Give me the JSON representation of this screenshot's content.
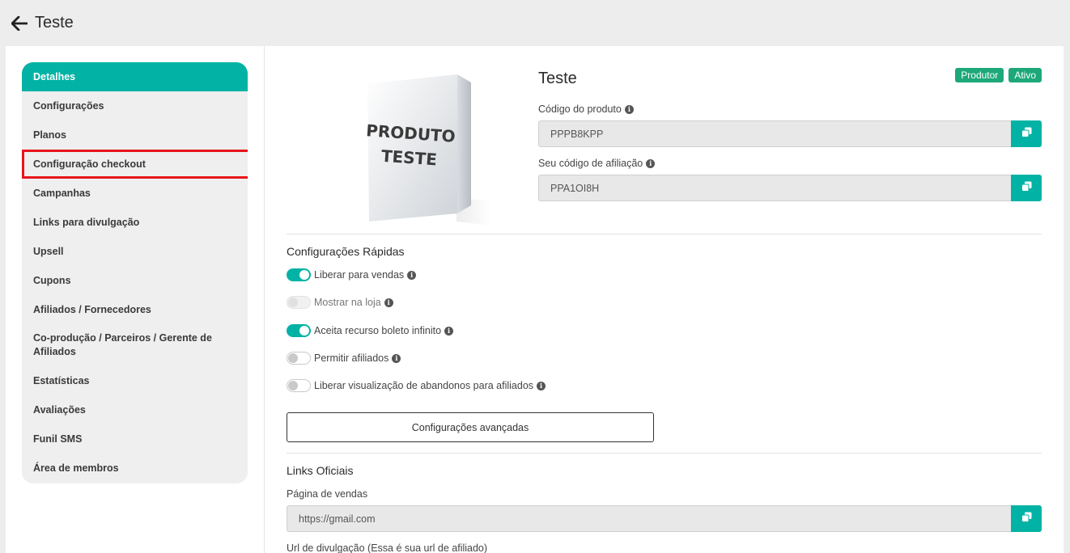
{
  "header": {
    "title": "Teste"
  },
  "sidebar": {
    "items": [
      {
        "label": "Detalhes"
      },
      {
        "label": "Configurações"
      },
      {
        "label": "Planos"
      },
      {
        "label": "Configuração checkout"
      },
      {
        "label": "Campanhas"
      },
      {
        "label": "Links para divulgação"
      },
      {
        "label": "Upsell"
      },
      {
        "label": "Cupons"
      },
      {
        "label": "Afiliados / Fornecedores"
      },
      {
        "label": "Co-produção / Parceiros / Gerente de Afiliados"
      },
      {
        "label": "Estatísticas"
      },
      {
        "label": "Avaliações"
      },
      {
        "label": "Funil SMS"
      },
      {
        "label": "Área de membros"
      }
    ]
  },
  "product": {
    "image_text_line1": "PRODUTO",
    "image_text_line2": "TESTE",
    "name": "Teste",
    "badges": [
      "Produtor",
      "Ativo"
    ],
    "code_label": "Código do produto",
    "code_value": "PPPB8KPP",
    "affiliate_label": "Seu código de afiliação",
    "affiliate_value": "PPA1OI8H"
  },
  "quick_settings": {
    "title": "Configurações Rápidas",
    "toggles": [
      {
        "label": "Liberar para vendas",
        "state": "on"
      },
      {
        "label": "Mostrar na loja",
        "state": "disabled"
      },
      {
        "label": "Aceita recurso boleto infinito",
        "state": "on"
      },
      {
        "label": "Permitir afiliados",
        "state": "off"
      },
      {
        "label": "Liberar visualização de abandonos para afiliados",
        "state": "off"
      }
    ],
    "advanced_button": "Configurações avançadas"
  },
  "official_links": {
    "title": "Links Oficiais",
    "sales_page_label": "Página de vendas",
    "sales_page_value": "https://gmail.com",
    "promo_url_label": "Url de divulgação (Essa é sua url de afiliado)"
  },
  "colors": {
    "accent": "#02b3a5",
    "badge": "#1da879",
    "highlight": "#e8141b"
  },
  "icons": {
    "back": "arrow-left-icon",
    "copy": "copy-icon",
    "info": "info-icon"
  }
}
